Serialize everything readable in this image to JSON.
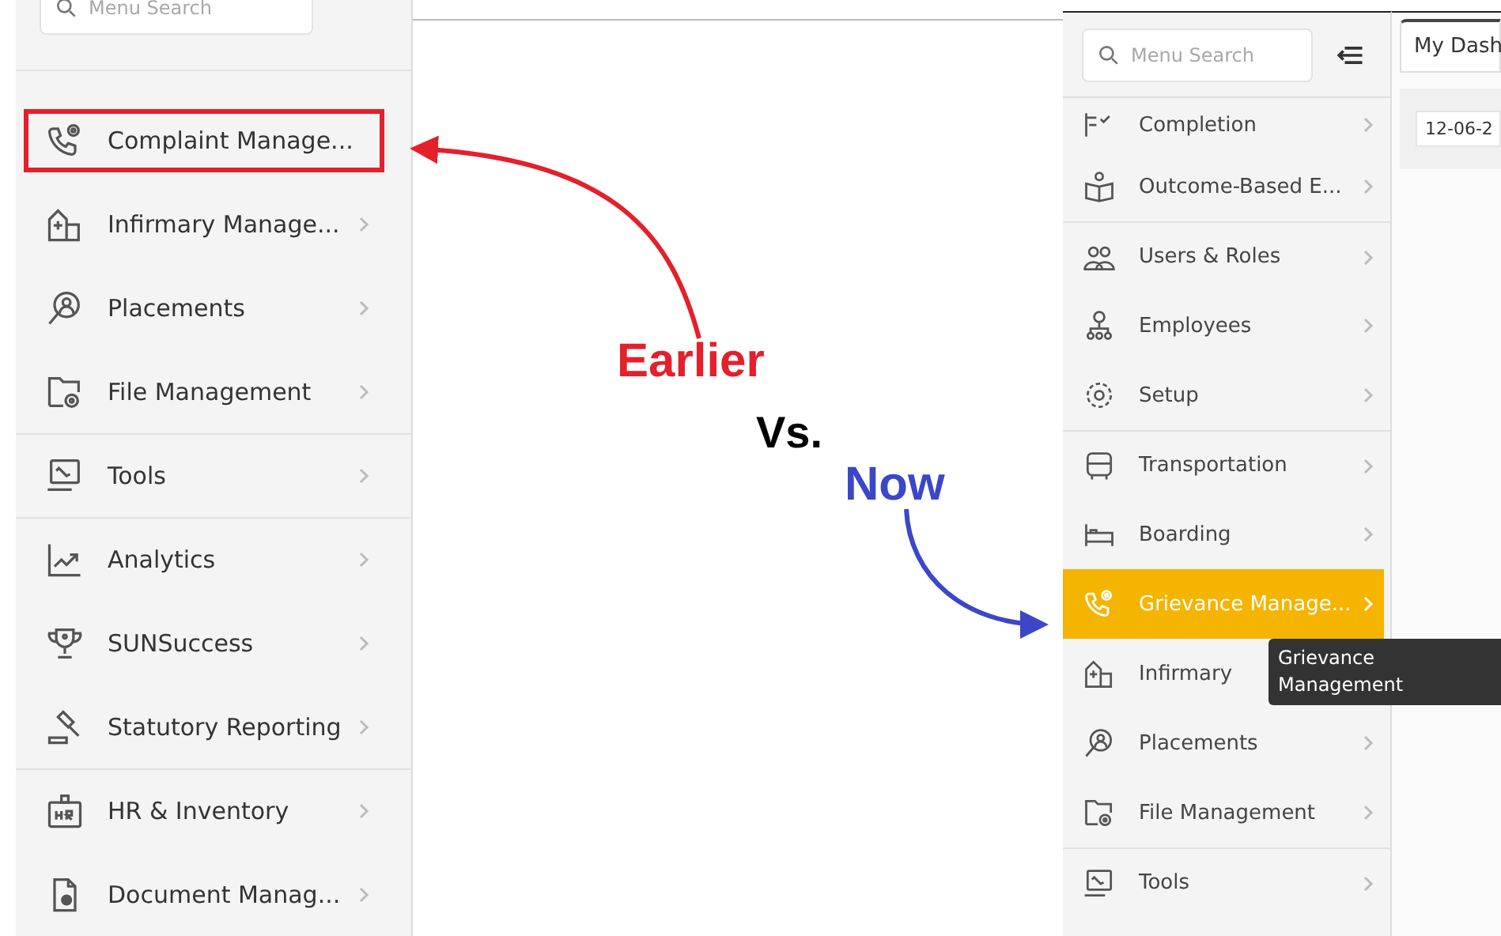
{
  "earlier_screen": {
    "search": {
      "placeholder": "Menu Search"
    },
    "menu": [
      {
        "label": "Complaint Manage...",
        "has_chevron": false,
        "outlined": true,
        "divider_before": false
      },
      {
        "label": "Infirmary Manage...",
        "has_chevron": true,
        "outlined": false,
        "divider_before": false
      },
      {
        "label": "Placements",
        "has_chevron": true,
        "outlined": false,
        "divider_before": false
      },
      {
        "label": "File Management",
        "has_chevron": true,
        "outlined": false,
        "divider_before": false
      },
      {
        "label": "Tools",
        "has_chevron": true,
        "outlined": false,
        "divider_before": true
      },
      {
        "label": "Analytics",
        "has_chevron": true,
        "outlined": false,
        "divider_before": true
      },
      {
        "label": "SUNSuccess",
        "has_chevron": true,
        "outlined": false,
        "divider_before": false
      },
      {
        "label": "Statutory Reporting",
        "has_chevron": true,
        "outlined": false,
        "divider_before": false
      },
      {
        "label": "HR & Inventory",
        "has_chevron": true,
        "outlined": false,
        "divider_before": true
      },
      {
        "label": "Document Manag...",
        "has_chevron": true,
        "outlined": false,
        "divider_before": false
      }
    ]
  },
  "annotations": [
    {
      "text": "Earlier",
      "color": "#e3202c"
    },
    {
      "text": "Vs.",
      "color": "#000000"
    },
    {
      "text": "Now",
      "color": "#3b47c8"
    }
  ],
  "now_screen": {
    "search": {
      "placeholder": "Menu Search"
    },
    "menu": [
      {
        "label": "Completion",
        "has_chevron": true,
        "selected": false,
        "divider_before": false
      },
      {
        "label": "Outcome-Based E...",
        "has_chevron": true,
        "selected": false,
        "divider_before": false
      },
      {
        "label": "Users & Roles",
        "has_chevron": true,
        "selected": false,
        "divider_before": true
      },
      {
        "label": "Employees",
        "has_chevron": true,
        "selected": false,
        "divider_before": false
      },
      {
        "label": "Setup",
        "has_chevron": true,
        "selected": false,
        "divider_before": false
      },
      {
        "label": "Transportation",
        "has_chevron": true,
        "selected": false,
        "divider_before": true
      },
      {
        "label": "Boarding",
        "has_chevron": true,
        "selected": false,
        "divider_before": false
      },
      {
        "label": "Grievance Manage...",
        "has_chevron": true,
        "selected": true,
        "divider_before": false
      },
      {
        "label": "Infirmary",
        "selected": false,
        "divider_before": false
      },
      {
        "label": "Placements",
        "has_chevron": true,
        "selected": false,
        "divider_before": false
      },
      {
        "label": "File Management",
        "has_chevron": true,
        "selected": false,
        "divider_before": false
      },
      {
        "label": "Tools",
        "has_chevron": true,
        "selected": false,
        "divider_before": true
      }
    ],
    "tooltip": "Grievance Management",
    "tab": {
      "label": "My Dash"
    },
    "date_field": {
      "value": "12-06-2"
    }
  }
}
